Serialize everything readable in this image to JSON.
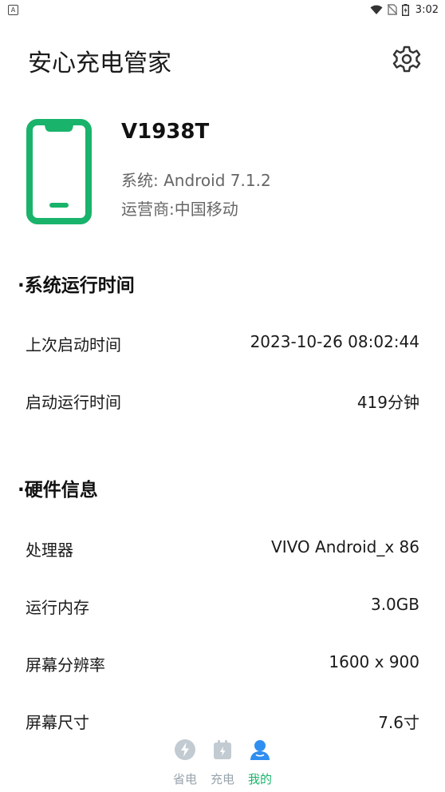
{
  "status_bar": {
    "time": "3:02"
  },
  "header": {
    "title": "安心充电管家",
    "settings_icon": "gear-icon"
  },
  "device": {
    "model": "V1938T",
    "system": "系统: Android 7.1.2",
    "carrier": "运营商:中国移动",
    "icon": "phone-icon",
    "accent_color": "#19b36b"
  },
  "uptime": {
    "title": "·系统运行时间",
    "rows": [
      {
        "label": "上次启动时间",
        "value": "2023-10-26 08:02:44"
      },
      {
        "label": "启动运行时间",
        "value": "419分钟"
      }
    ]
  },
  "hardware": {
    "title": "·硬件信息",
    "rows": [
      {
        "label": "处理器",
        "value": "VIVO Android_x 86"
      },
      {
        "label": "运行内存",
        "value": "3.0GB"
      },
      {
        "label": "屏幕分辨率",
        "value": "1600 x 900"
      },
      {
        "label": "屏幕尺寸",
        "value": "7.6寸"
      }
    ]
  },
  "bottom_nav": {
    "items": [
      {
        "label": "省电",
        "icon": "lightning-icon",
        "active": false
      },
      {
        "label": "充电",
        "icon": "calendar-battery-icon",
        "active": false
      },
      {
        "label": "我的",
        "icon": "user-icon",
        "active": true
      }
    ],
    "active_color": "#19b36b",
    "inactive_color": "#9aa4ad"
  }
}
